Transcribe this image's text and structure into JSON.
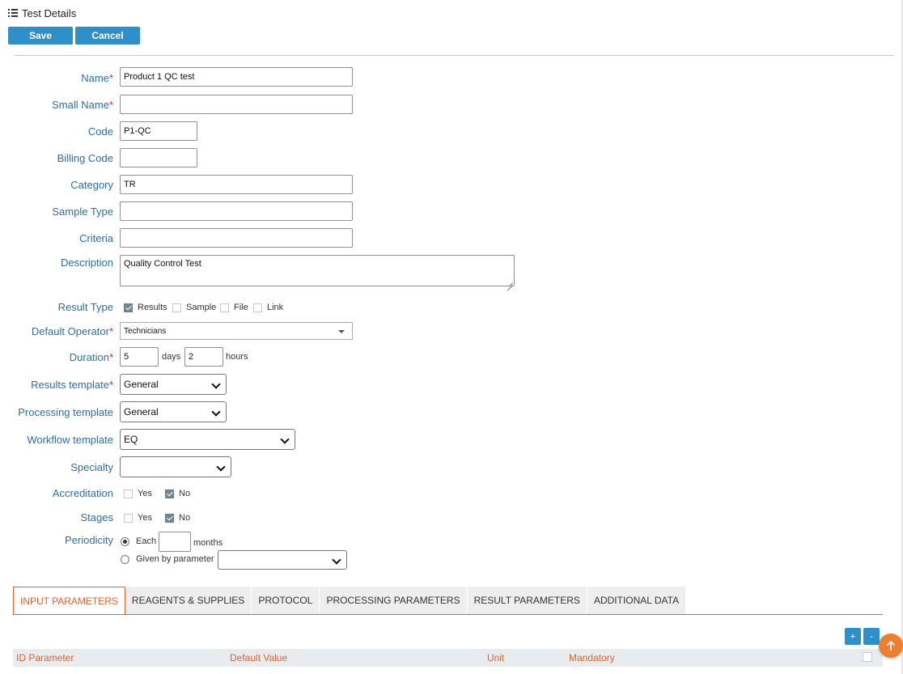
{
  "header": {
    "title": "Test Details",
    "icon": "list-icon"
  },
  "toolbar": {
    "save_label": "Save",
    "cancel_label": "Cancel"
  },
  "form": {
    "name": {
      "label": "Name",
      "required": "*",
      "value": "Product 1 QC test"
    },
    "small_name": {
      "label": "Small Name",
      "required": "*",
      "value": ""
    },
    "code": {
      "label": "Code",
      "value": "P1-QC"
    },
    "billing_code": {
      "label": "Billing Code",
      "value": ""
    },
    "category": {
      "label": "Category",
      "value": "TR"
    },
    "sample_type": {
      "label": "Sample Type",
      "value": ""
    },
    "criteria": {
      "label": "Criteria",
      "value": ""
    },
    "description": {
      "label": "Description",
      "value": "Quality Control Test"
    },
    "result_type": {
      "label": "Result Type",
      "options": [
        {
          "label": "Results",
          "checked": true
        },
        {
          "label": "Sample",
          "checked": false
        },
        {
          "label": "File",
          "checked": false
        },
        {
          "label": "Link",
          "checked": false
        }
      ]
    },
    "default_operator": {
      "label": "Default Operator",
      "required": "*",
      "value": "Technicians"
    },
    "duration": {
      "label": "Duration",
      "required": "*",
      "days": "5",
      "days_unit": "days",
      "hours": "2",
      "hours_unit": "hours"
    },
    "results_template": {
      "label": "Results template",
      "required": "*",
      "value": "General"
    },
    "processing_template": {
      "label": "Processing template",
      "value": "General"
    },
    "workflow_template": {
      "label": "Workflow template",
      "value": "EQ"
    },
    "specialty": {
      "label": "Specialty",
      "value": ""
    },
    "accreditation": {
      "label": "Accreditation",
      "yes": "Yes",
      "no": "No",
      "selected": "No"
    },
    "stages": {
      "label": "Stages",
      "yes": "Yes",
      "no": "No",
      "selected": "No"
    },
    "periodicity": {
      "label": "Periodicity",
      "each_label": "Each",
      "each_value": "",
      "each_unit": "months",
      "given_label": "Given by parameter",
      "given_value": "",
      "selected": "each"
    }
  },
  "tabs": [
    {
      "label": "INPUT PARAMETERS",
      "active": true
    },
    {
      "label": "REAGENTS & SUPPLIES",
      "active": false
    },
    {
      "label": "PROTOCOL",
      "active": false
    },
    {
      "label": "PROCESSING PARAMETERS",
      "active": false
    },
    {
      "label": "RESULT PARAMETERS",
      "active": false
    },
    {
      "label": "ADDITIONAL DATA",
      "active": false
    }
  ],
  "table": {
    "add_label": "+",
    "remove_label": "-",
    "columns": [
      "ID Parameter",
      "Default Value",
      "Unit",
      "Mandatory"
    ]
  },
  "colors": {
    "accent": "#2f8fc8",
    "label": "#2a6fa8",
    "tab_active": "#e2612a",
    "fab": "#ee7e30"
  }
}
